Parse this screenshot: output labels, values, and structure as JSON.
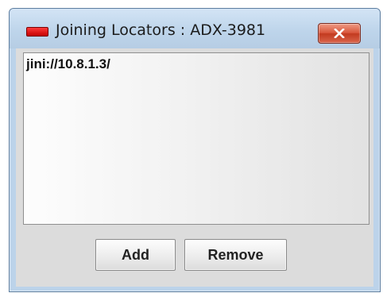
{
  "window": {
    "title": "Joining Locators : ADX-3981",
    "close_label": "Close"
  },
  "locators": {
    "items": [
      "jini://10.8.1.3/"
    ]
  },
  "buttons": {
    "add_label": "Add",
    "remove_label": "Remove"
  },
  "icons": {
    "app_icon": "red-led-icon",
    "close_icon": "close-x-icon"
  },
  "colors": {
    "app_icon": "#e00000",
    "close_button": "#d8553a",
    "titlebar": "#c6dcf1"
  }
}
